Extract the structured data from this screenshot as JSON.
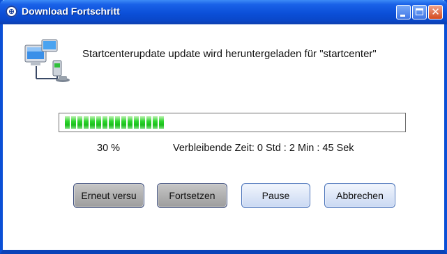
{
  "window": {
    "title": "Download Fortschritt",
    "icon": "app-globe-icon",
    "controls": [
      "minimize-icon",
      "maximize-icon",
      "close-icon"
    ]
  },
  "message": "Startcenterupdate update wird heruntergeladen für \"startcenter\"",
  "progress": {
    "fraction": 0.3,
    "percent_label": "30 %",
    "remaining_label": "Verbleibende Zeit: 0 Std : 2 Min : 45 Sek",
    "fill_color": "#22c922"
  },
  "buttons": {
    "retry": "Erneut versu",
    "resume": "Fortsetzen",
    "pause": "Pause",
    "cancel": "Abbrechen"
  },
  "colors": {
    "titlebar": "#0b4fd8",
    "button_disabled": "#a9a9a9",
    "button_enabled": "#d6e2f6"
  }
}
